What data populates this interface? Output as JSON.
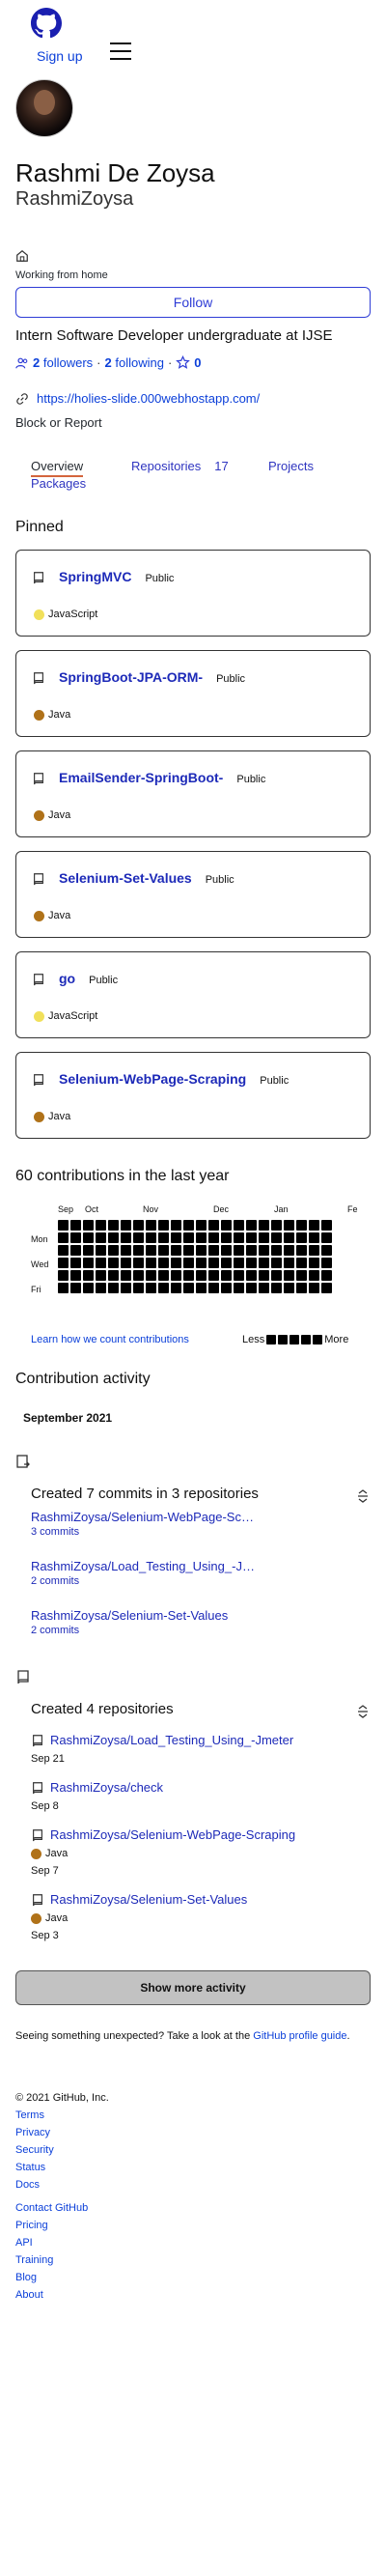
{
  "header": {
    "signup_label": "Sign up"
  },
  "profile": {
    "name": "Rashmi De Zoysa",
    "login": "RashmiZoysa",
    "status": "Working from home",
    "follow_label": "Follow",
    "bio": "Intern Software Developer undergraduate at IJSE",
    "followers_count": "2",
    "followers_label": "followers",
    "separator": "·",
    "following_count": "2",
    "following_label": "following",
    "stars_count": "0",
    "website": "https://holies-slide.000webhostapp.com/",
    "block_label": "Block or Report"
  },
  "tabs": [
    {
      "label": "Overview"
    },
    {
      "label": "Repositories",
      "count": "17"
    },
    {
      "label": "Projects"
    },
    {
      "label": "Packages"
    }
  ],
  "pinned": {
    "title": "Pinned",
    "repos": [
      {
        "name": "SpringMVC",
        "visibility": "Public",
        "language": "JavaScript",
        "lang_color": "#f1e05a"
      },
      {
        "name": "SpringBoot-JPA-ORM-",
        "visibility": "Public",
        "language": "Java",
        "lang_color": "#b07219"
      },
      {
        "name": "EmailSender-SpringBoot-",
        "visibility": "Public",
        "language": "Java",
        "lang_color": "#b07219"
      },
      {
        "name": "Selenium-Set-Values",
        "visibility": "Public",
        "language": "Java",
        "lang_color": "#b07219"
      },
      {
        "name": "go",
        "visibility": "Public",
        "language": "JavaScript",
        "lang_color": "#f1e05a"
      },
      {
        "name": "Selenium-WebPage-Scraping",
        "visibility": "Public",
        "language": "Java",
        "lang_color": "#b07219"
      }
    ]
  },
  "contributions": {
    "title": "60 contributions in the last year",
    "months": [
      "Sep",
      "Oct",
      "Nov",
      "Dec",
      "Jan",
      "Fe"
    ],
    "days": [
      "Mon",
      "Wed",
      "Fri"
    ],
    "learn_label": "Learn how we count contributions",
    "less_label": "Less",
    "more_label": "More"
  },
  "activity": {
    "title": "Contribution activity",
    "month": "September 2021",
    "commits": {
      "title": "Created 7 commits in 3 repositories",
      "items": [
        {
          "repo": "RashmiZoysa/Selenium-WebPage-Sc…",
          "sub": "3 commits"
        },
        {
          "repo": "RashmiZoysa/Load_Testing_Using_-J…",
          "sub": "2 commits"
        },
        {
          "repo": "RashmiZoysa/Selenium-Set-Values",
          "sub": "2 commits"
        }
      ]
    },
    "repos": {
      "title": "Created 4 repositories",
      "items": [
        {
          "repo": "RashmiZoysa/Load_Testing_Using_-Jmeter",
          "language": "",
          "date": "Sep 21"
        },
        {
          "repo": "RashmiZoysa/check",
          "language": "",
          "date": "Sep 8"
        },
        {
          "repo": "RashmiZoysa/Selenium-WebPage-Scraping",
          "language": "Java",
          "date": "Sep 7"
        },
        {
          "repo": "RashmiZoysa/Selenium-Set-Values",
          "language": "Java",
          "date": "Sep 3"
        }
      ]
    },
    "more_label": "Show more activity",
    "unexpected_text": "Seeing something unexpected? Take a look at the",
    "unexpected_link": "GitHub profile guide",
    "unexpected_end": "."
  },
  "footer": {
    "copyright": "© 2021 GitHub, Inc.",
    "links_a": [
      "Terms",
      "Privacy",
      "Security",
      "Status",
      "Docs"
    ],
    "links_b": [
      "Contact GitHub",
      "Pricing",
      "API",
      "Training",
      "Blog",
      "About"
    ]
  }
}
